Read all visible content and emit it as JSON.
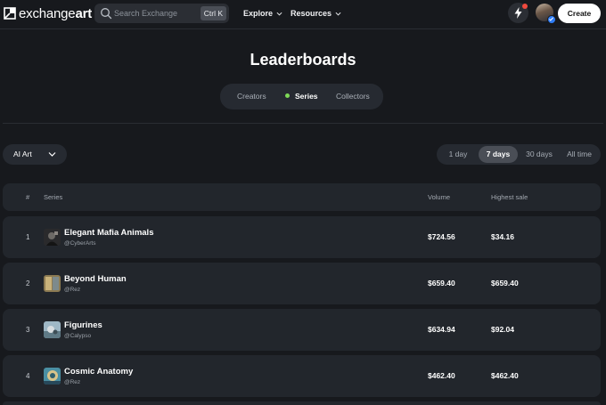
{
  "header": {
    "logo_light": "exchange",
    "logo_bold": "art",
    "search_placeholder": "Search Exchange",
    "search_shortcut": "Ctrl K",
    "nav": [
      {
        "label": "Explore"
      },
      {
        "label": "Resources"
      }
    ],
    "create_label": "Create",
    "colors": {
      "notification": "#f04a3e",
      "verified": "#2f7df6"
    }
  },
  "page": {
    "title": "Leaderboards",
    "tabs": [
      {
        "label": "Creators",
        "active": false
      },
      {
        "label": "Series",
        "active": true
      },
      {
        "label": "Collectors",
        "active": false
      }
    ],
    "active_dot_color": "#7ed957"
  },
  "filters": {
    "category": "AI Art",
    "time_ranges": [
      {
        "label": "1 day",
        "active": false
      },
      {
        "label": "7 days",
        "active": true
      },
      {
        "label": "30 days",
        "active": false
      },
      {
        "label": "All time",
        "active": false
      }
    ]
  },
  "table": {
    "columns": {
      "rank": "#",
      "series": "Series",
      "volume": "Volume",
      "highest_sale": "Highest sale"
    },
    "rows": [
      {
        "rank": "1",
        "name": "Elegant Mafia Animals",
        "handle": "@CyberArts",
        "volume": "$724.56",
        "highest_sale": "$34.16"
      },
      {
        "rank": "2",
        "name": "Beyond Human",
        "handle": "@Rez",
        "volume": "$659.40",
        "highest_sale": "$659.40"
      },
      {
        "rank": "3",
        "name": "Figurines",
        "handle": "@Calypso",
        "volume": "$634.94",
        "highest_sale": "$92.04"
      },
      {
        "rank": "4",
        "name": "Cosmic Anatomy",
        "handle": "@Rez",
        "volume": "$462.40",
        "highest_sale": "$462.40"
      }
    ]
  }
}
